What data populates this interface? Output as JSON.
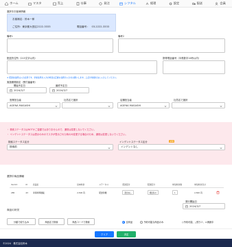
{
  "nav": [
    {
      "label": "ホーム",
      "icon": "home-icon"
    },
    {
      "label": "マスタ",
      "icon": "folder-icon"
    },
    {
      "label": "売上",
      "icon": "sales-icon"
    },
    {
      "label": "仕事",
      "icon": "job-icon"
    },
    {
      "label": "発注",
      "icon": "order-icon"
    },
    {
      "label": "シフタル",
      "icon": "shift-icon",
      "active": true
    },
    {
      "label": "経理",
      "icon": "ledger-icon"
    },
    {
      "label": "設定",
      "icon": "gear-icon"
    },
    {
      "label": "配送",
      "icon": "truck-icon"
    },
    {
      "label": "会員",
      "icon": "user-icon"
    }
  ],
  "customer": {
    "section_label": "選択中お客様情報",
    "name_line": "お客様名：鈴木一郎",
    "address_line": "ご住所：東京都大田区2222-3333",
    "phone_line": "電話番号：　03-2222-3333"
  },
  "remarks": {
    "label1": "備考1",
    "label2": "備考2"
  },
  "delivery": {
    "address_label": "配送先住所（215文字以内）",
    "phone_label": "携帯電話番号（半角数字16桁以内）",
    "note": "※ 配送先住所は入力必須です。手動住所を入力の場合は正確な住所の入力をお願いします。上記の情報のみに入力してください。"
  },
  "request": {
    "section_label": "実施期間設定（受付番番号）",
    "start_label": "開始予定日",
    "start_value": "2024/3/7",
    "end_label": "最終予定日",
    "end_value": "2024/3/7"
  },
  "staff": {
    "owner_label": "営業担当者",
    "owner_value": "AGENA MASASHI",
    "company_label": "社員名で選択",
    "operator_label": "店舗担当者",
    "operator_value": "AGENA MASASHI",
    "company2_label": "社員名で選択"
  },
  "warnings": {
    "line1": "・ 検索ステータスはNOTかご金額ではありませんので、通常は変更しないでください。",
    "line2": "・ インデントステータスは表示のみのマスタが表示された時のみ変更する場合のため、通常は変更しないでください。"
  },
  "status": {
    "search_label": "検索ステータス区分",
    "search_value": "検索前",
    "indent_label": "インデントステータス区分",
    "indent_badge": "必須",
    "indent_value": "インデントなし"
  },
  "products": {
    "section_label": "選択中商品情報",
    "columns": [
      "ItemID",
      "ID",
      "商品名",
      "基本料金",
      "ステータス",
      "配送区分",
      "配送区分",
      "単位料金数",
      "単位料金合計"
    ],
    "rows": [
      {
        "item_id": "285",
        "id": "43",
        "name": "専用車両積載",
        "price": "2,500 円",
        "status": "配送待機",
        "ship1": "選出なし",
        "ship2": "発送有の",
        "qty": "1",
        "total": "2,500 円"
      }
    ]
  },
  "delivery_date": {
    "label": "発行開始日",
    "value": "2024/3/7"
  },
  "product_status_label": "商品の状況",
  "buttons": {
    "split": "分類で絞り込み",
    "search_name": "商品名で検索",
    "search_code": "商品コードで検索"
  },
  "radios": [
    {
      "label": "全商品",
      "checked": true
    },
    {
      "label": "予約可能な商品のみ",
      "checked": false
    },
    {
      "label": "○予約可能、△残り少、×満席中",
      "checked": false
    }
  ],
  "actions": {
    "clear": "クリア",
    "ok": "決定"
  },
  "footer": "©2024　株式会社鈴木"
}
